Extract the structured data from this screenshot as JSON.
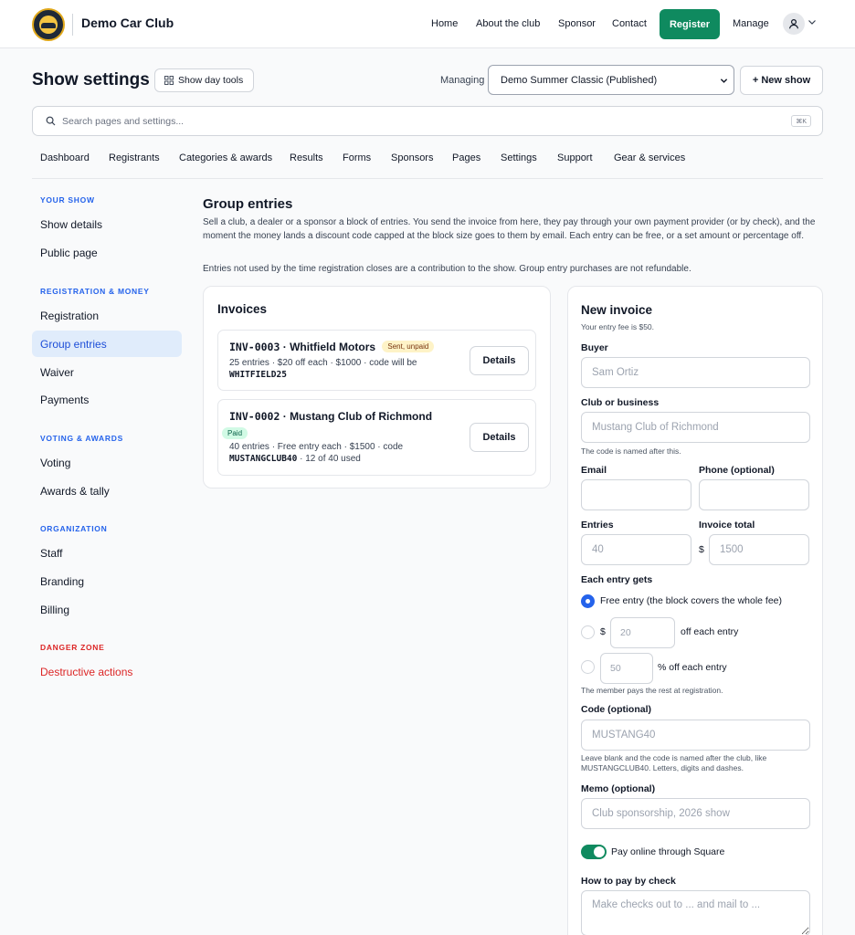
{
  "topbar": {
    "brand": "Demo Car Club",
    "nav": [
      "Home",
      "About the club",
      "Sponsor",
      "Contact"
    ],
    "register": "Register",
    "manage": "Manage"
  },
  "header": {
    "title": "Show settings",
    "tools": "Show day tools",
    "managing_label": "Managing",
    "selected_show": "Demo Summer Classic (Published)",
    "new_show": "+ New show"
  },
  "search": {
    "placeholder": "Search pages and settings...",
    "shortcut": "⌘K"
  },
  "tabs": [
    "Dashboard",
    "Registrants",
    "Categories & awards",
    "Results",
    "Forms",
    "Sponsors",
    "Pages",
    "Settings",
    "Support",
    "Gear & services"
  ],
  "sidebar": {
    "sections": [
      {
        "heading": "YOUR SHOW",
        "items": [
          "Show details",
          "Public page"
        ]
      },
      {
        "heading": "REGISTRATION & MONEY",
        "items": [
          "Registration",
          "Group entries",
          "Waiver",
          "Payments"
        ]
      },
      {
        "heading": "VOTING & AWARDS",
        "items": [
          "Voting",
          "Awards & tally"
        ]
      },
      {
        "heading": "ORGANIZATION",
        "items": [
          "Staff",
          "Branding",
          "Billing"
        ]
      },
      {
        "heading": "DANGER ZONE",
        "items": [
          "Destructive actions"
        ]
      }
    ],
    "active": "Group entries"
  },
  "main": {
    "title": "Group entries",
    "intro_1": "Sell a club, a dealer or a sponsor a block of entries. You send the invoice from here, they pay through your own payment provider (or by check), and the moment the money lands a discount code capped at the block size goes to them by email. Each entry can be free, or a set amount or percentage off.",
    "intro_2": "Entries not used by the time registration closes are a contribution to the show. Group entry purchases are not refundable."
  },
  "invoices": {
    "title": "Invoices",
    "details_label": "Details",
    "items": [
      {
        "number": "INV-0003",
        "sep": " · ",
        "name": "Whitfield Motors",
        "status": "Sent, unpaid",
        "meta": "25 entries · $20 off each · $1000 · code will be",
        "code": "WHITFIELD25",
        "usage": ""
      },
      {
        "number": "INV-0002",
        "sep": " · ",
        "name": "Mustang Club of Richmond",
        "status": "Paid",
        "meta": "40 entries · Free entry each · $1500 · code",
        "code": "MUSTANGCLUB40",
        "usage": " · 12 of 40 used"
      }
    ]
  },
  "form": {
    "title": "New invoice",
    "fee_note": "Your entry fee is $50.",
    "buyer_label": "Buyer",
    "buyer_placeholder": "Sam Ortiz",
    "club_label": "Club or business",
    "club_placeholder": "Mustang Club of Richmond",
    "club_note": "The code is named after this.",
    "email_label": "Email",
    "phone_label": "Phone (optional)",
    "entries_label": "Entries",
    "entries_placeholder": "40",
    "total_label": "Invoice total",
    "currency": "$",
    "total_placeholder": "1500",
    "entry_gets_label": "Each entry gets",
    "opt_free": "Free entry (the block covers the whole fee)",
    "opt_amount_currency": "$",
    "opt_amount_placeholder": "20",
    "opt_amount_suffix": "off each entry",
    "opt_percent_placeholder": "50",
    "opt_percent_suffix": "% off each entry",
    "selected_option": "free",
    "member_note": "The member pays the rest at registration.",
    "code_label": "Code (optional)",
    "code_placeholder": "MUSTANG40",
    "code_note": "Leave blank and the code is named after the club, like MUSTANGCLUB40. Letters, digits and dashes.",
    "memo_label": "Memo (optional)",
    "memo_placeholder": "Club sponsorship, 2026 show",
    "pay_online_label": "Pay online through Square",
    "pay_online_enabled": true,
    "check_label": "How to pay by check",
    "check_placeholder": "Make checks out to ... and mail to ..."
  },
  "colors": {
    "accent": "#0f8a5f",
    "link": "#2563eb",
    "danger": "#dc2626",
    "active_bg": "#e0ecfb"
  }
}
